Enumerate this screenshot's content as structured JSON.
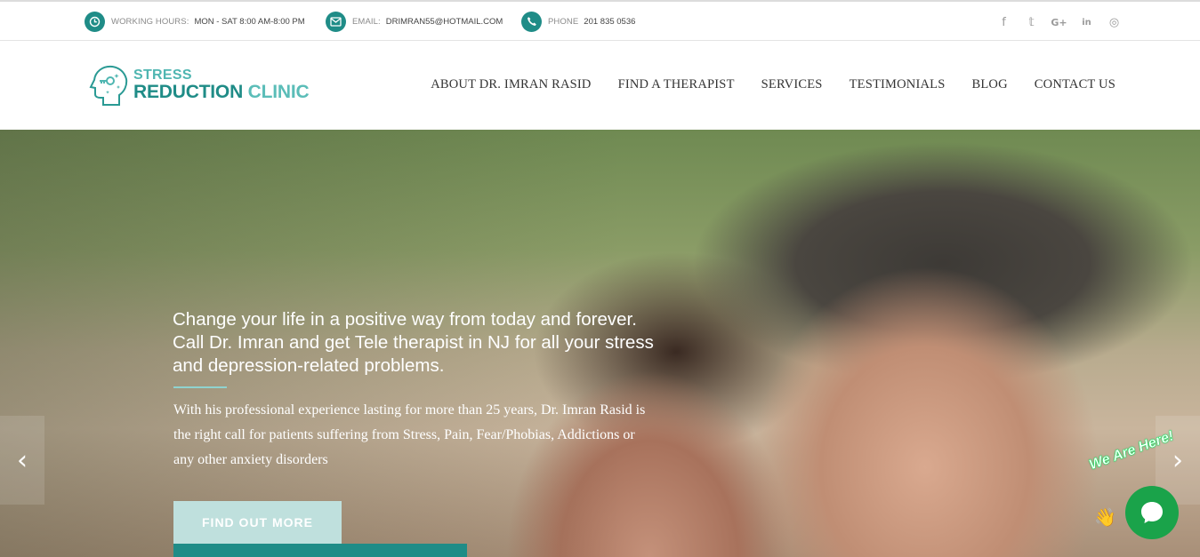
{
  "topbar": {
    "hours_label": "Working Hours:",
    "hours_value": "Mon - Sat 8:00 AM-8:00 PM",
    "email_label": "Email:",
    "email_value": "drimran55@hotmail.com",
    "phone_label": "Phone",
    "phone_value": "201 835 0536",
    "social": [
      {
        "icon": "facebook-icon",
        "glyph": "f"
      },
      {
        "icon": "twitter-icon",
        "glyph": "𝕥"
      },
      {
        "icon": "google-plus-icon",
        "glyph": "G+"
      },
      {
        "icon": "linkedin-icon",
        "glyph": "in"
      },
      {
        "icon": "instagram-icon",
        "glyph": "◎"
      }
    ]
  },
  "logo": {
    "line1": "STRESS",
    "line2a": "REDUCTION",
    "line2b": "CLINIC"
  },
  "nav": {
    "items": [
      "ABOUT DR. IMRAN RASID",
      "FIND A THERAPIST",
      "SERVICES",
      "TESTIMONIALS",
      "BLOG",
      "CONTACT US"
    ]
  },
  "hero": {
    "title": "Change your life in a positive way from today and forever. Call Dr. Imran and get Tele therapist in NJ for all your stress and depression-related problems.",
    "description": "With his professional experience lasting for more than 25 years, Dr. Imran Rasid is the right call for patients suffering from Stress, Pain, Fear/Phobias, Addictions or any other anxiety disorders",
    "cta": "FIND OUT MORE",
    "prev_glyph": "‹",
    "next_glyph": "›"
  },
  "chat": {
    "tag": "We Are Here!",
    "wave": "👋"
  },
  "colors": {
    "brand": "#1f8c87",
    "brand_light": "#5bbdb8",
    "cta_bg": "#bfe0dd",
    "chat": "#1aa34a"
  }
}
